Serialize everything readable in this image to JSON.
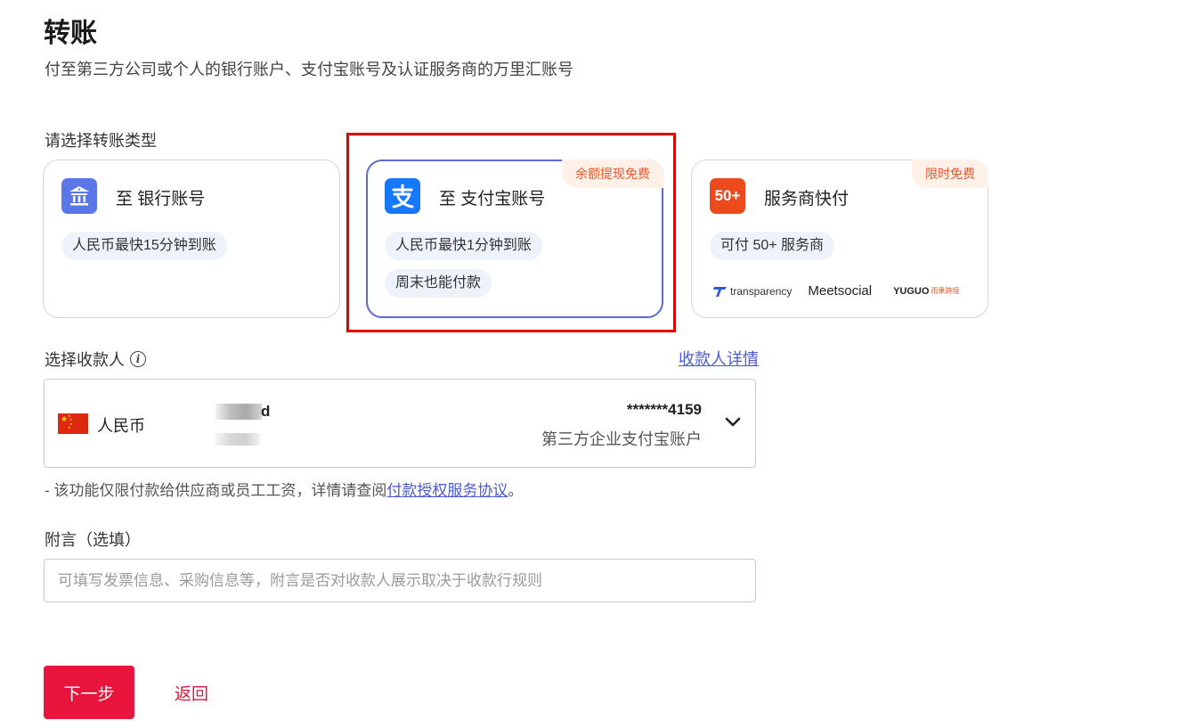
{
  "header": {
    "title": "转账",
    "subtitle": "付至第三方公司或个人的银行账户、支付宝账号及认证服务商的万里汇账号"
  },
  "transfer_type": {
    "label": "请选择转账类型",
    "options": [
      {
        "title": "至 银行账号",
        "icon": "bank-icon",
        "tags": [
          "人民币最快15分钟到账"
        ],
        "badge": "",
        "selected": false
      },
      {
        "title": "至 支付宝账号",
        "icon": "alipay-icon",
        "tags": [
          "人民币最快1分钟到账",
          "周末也能付款"
        ],
        "badge": "余额提现免费",
        "selected": true
      },
      {
        "title": "服务商快付",
        "icon_text": "50+",
        "icon": "provider-50-icon",
        "tags": [
          "可付 50+ 服务商"
        ],
        "badge": "限时免费",
        "selected": false,
        "partners": [
          "transparency",
          "Meetsocial",
          "YUGUO",
          "雨果跨境"
        ]
      }
    ]
  },
  "payee": {
    "label": "选择收款人",
    "details_link": "收款人详情",
    "currency": "人民币",
    "name_suffix": "d",
    "account_number": "*******4159",
    "account_type": "第三方企业支付宝账户"
  },
  "notice": {
    "prefix": "- 该功能仅限付款给供应商或员工工资，详情请查阅",
    "link": "付款授权服务协议",
    "suffix": "。"
  },
  "memo": {
    "label": "附言（选填）",
    "placeholder": "可填写发票信息、采购信息等，附言是否对收款人展示取决于收款行规则"
  },
  "actions": {
    "next": "下一步",
    "back": "返回"
  },
  "colors": {
    "primary": "#e8143c",
    "link": "#4a5bd0",
    "selected_border": "#5b6bd6",
    "badge_text": "#e8562a",
    "annotation": "#e60000"
  }
}
